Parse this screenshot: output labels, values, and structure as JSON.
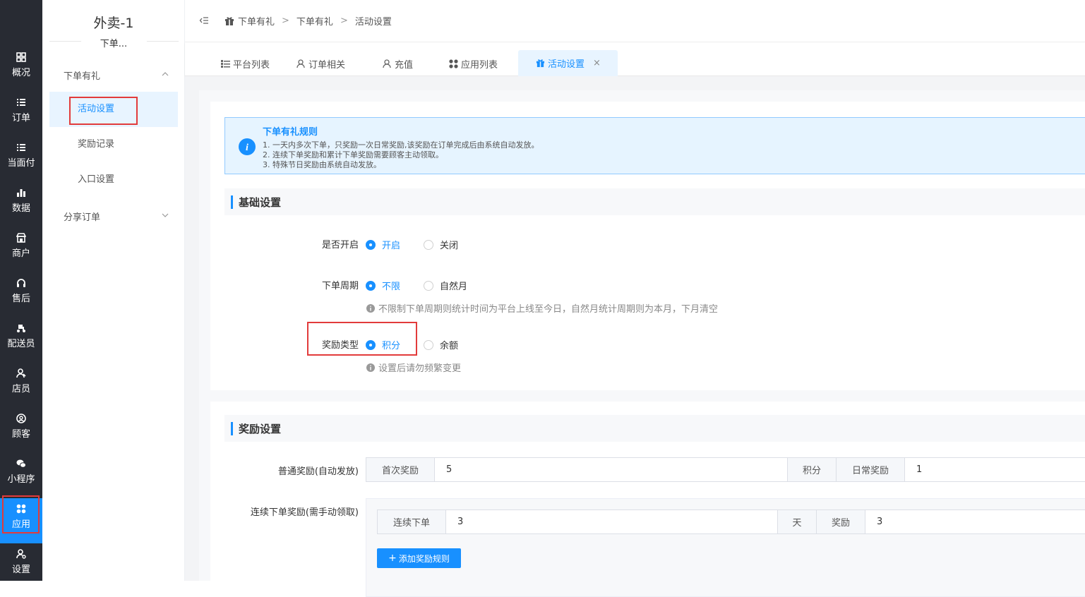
{
  "leftnav": {
    "items": [
      {
        "label": "概况",
        "icon": "grid-icon"
      },
      {
        "label": "订单",
        "icon": "list-icon"
      },
      {
        "label": "当面付",
        "icon": "list-icon"
      },
      {
        "label": "数据",
        "icon": "bar-chart-icon"
      },
      {
        "label": "商户",
        "icon": "store-icon"
      },
      {
        "label": "售后",
        "icon": "headset-icon"
      },
      {
        "label": "配送员",
        "icon": "scooter-icon"
      },
      {
        "label": "店员",
        "icon": "users-icon"
      },
      {
        "label": "顾客",
        "icon": "user-circle-icon"
      },
      {
        "label": "小程序",
        "icon": "wechat-icon"
      },
      {
        "label": "应用",
        "icon": "apps-icon"
      },
      {
        "label": "设置",
        "icon": "user-gear-icon"
      }
    ],
    "active_index": 10
  },
  "subnav": {
    "title": "外卖-1",
    "subtitle": "下单...",
    "group1": "下单有礼",
    "items": [
      "活动设置",
      "奖励记录",
      "入口设置"
    ],
    "group2": "分享订单"
  },
  "breadcrumb": {
    "items": [
      "下单有礼",
      "下单有礼",
      "活动设置"
    ],
    "sep": ">"
  },
  "tabs": [
    {
      "label": "平台列表",
      "icon": "list-icon"
    },
    {
      "label": "订单相关",
      "icon": "user-icon"
    },
    {
      "label": "充值",
      "icon": "user-icon"
    },
    {
      "label": "应用列表",
      "icon": "apps-icon"
    },
    {
      "label": "活动设置",
      "icon": "gift-icon",
      "close": "×"
    }
  ],
  "alert": {
    "title": "下单有礼规则",
    "lines": [
      "1. 一天内多次下单，只奖励一次日常奖励,该奖励在订单完成后由系统自动发放。",
      "2. 连续下单奖励和累计下单奖励需要顾客主动领取。",
      "3. 特殊节日奖励由系统自动发放。"
    ]
  },
  "basic": {
    "heading": "基础设置",
    "enable": {
      "label": "是否开启",
      "options": [
        "开启",
        "关闭"
      ],
      "selected": 0
    },
    "period": {
      "label": "下单周期",
      "options": [
        "不限",
        "自然月"
      ],
      "selected": 0,
      "hint": "不限制下单周期则统计时间为平台上线至今日，自然月统计周期则为本月，下月清空"
    },
    "reward_type": {
      "label": "奖励类型",
      "options": [
        "积分",
        "余额"
      ],
      "selected": 0,
      "hint": "设置后请勿频繁变更"
    }
  },
  "reward": {
    "heading": "奖励设置",
    "normal": {
      "label": "普通奖励(自动发放)",
      "first_label": "首次奖励",
      "first_value": "5",
      "unit": "积分",
      "daily_label": "日常奖励",
      "daily_value": "1"
    },
    "continuous": {
      "label": "连续下单奖励(需手动领取)",
      "prefix": "连续下单",
      "days": "3",
      "days_unit": "天",
      "reward_label": "奖励",
      "reward_value": "3"
    },
    "add_button": "添加奖励规则"
  },
  "colors": {
    "primary": "#1890ff",
    "sidebar": "#282b33",
    "highlight": "#e23b3b"
  }
}
